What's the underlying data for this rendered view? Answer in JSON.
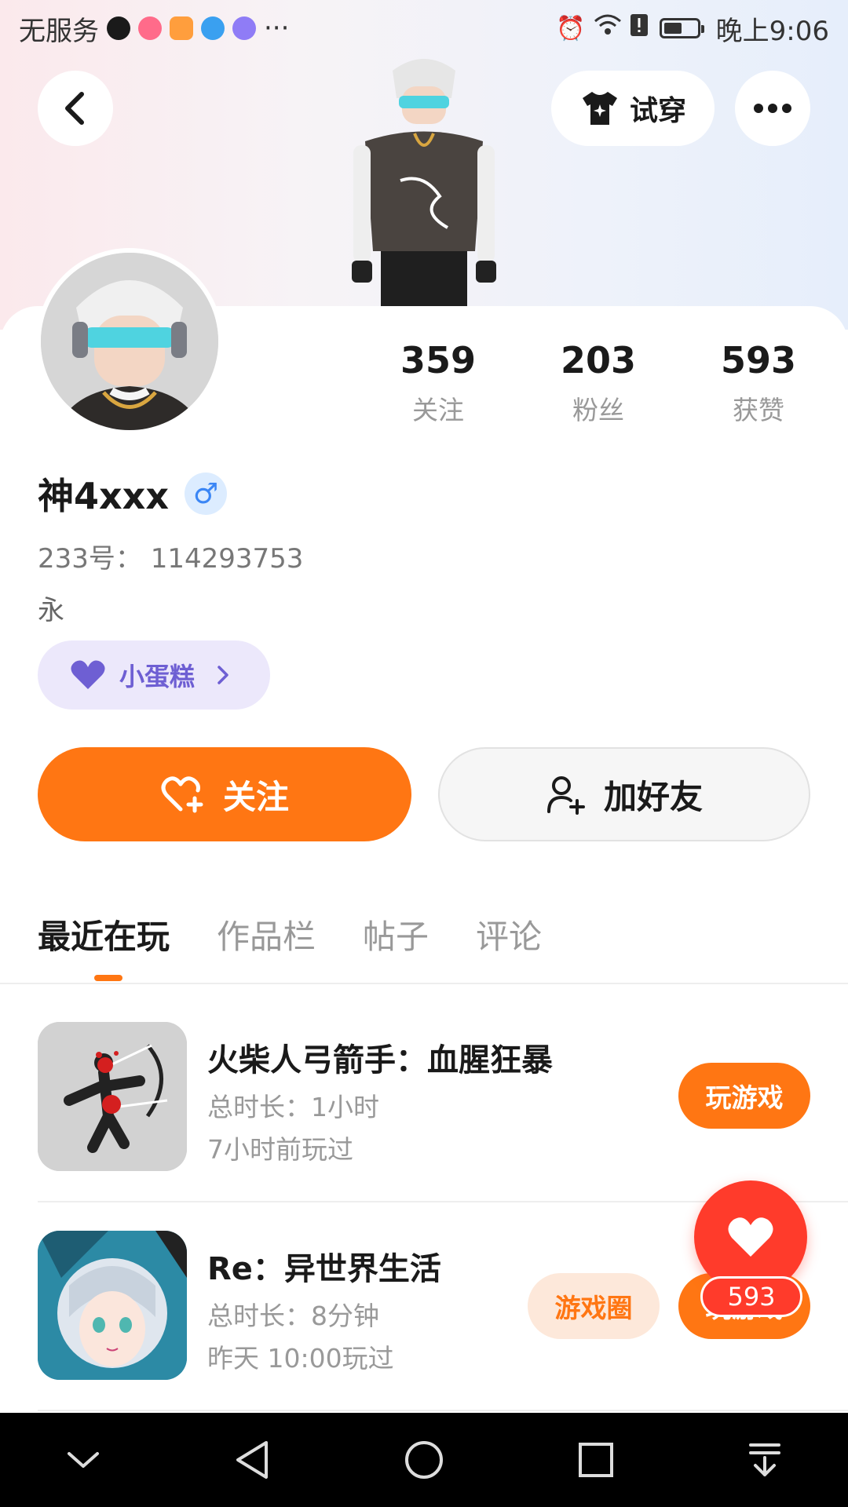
{
  "status_bar": {
    "carrier": "无服务",
    "more": "···",
    "time": "晚上9:06"
  },
  "header": {
    "tryon_label": "试穿"
  },
  "stats": [
    {
      "num": "359",
      "label": "关注"
    },
    {
      "num": "203",
      "label": "粉丝"
    },
    {
      "num": "593",
      "label": "获赞"
    }
  ],
  "profile": {
    "username": "神4xxx",
    "gender_symbol": "♂",
    "id_text": "233号： 114293753",
    "bio": "永",
    "badge_label": "小蛋糕"
  },
  "actions": {
    "follow_label": "关注",
    "friend_label": "加好友"
  },
  "tabs": [
    {
      "label": "最近在玩",
      "active": true
    },
    {
      "label": "作品栏",
      "active": false
    },
    {
      "label": "帖子",
      "active": false
    },
    {
      "label": "评论",
      "active": false
    }
  ],
  "games": [
    {
      "name": "火柴人弓箭手：血腥狂暴",
      "duration": "总时长：1小时",
      "last_played": "7小时前玩过",
      "play_label": "玩游戏"
    },
    {
      "name": "Re：异世界生活",
      "duration": "总时长：8分钟",
      "last_played": "昨天 10:00玩过",
      "circle_label": "游戏圈",
      "play_label": "玩游戏"
    }
  ],
  "floating_like": {
    "count": "593"
  },
  "colors": {
    "accent": "#ff7613",
    "like_red": "#ff3b2b",
    "badge_purple": "#6e5fd3"
  }
}
